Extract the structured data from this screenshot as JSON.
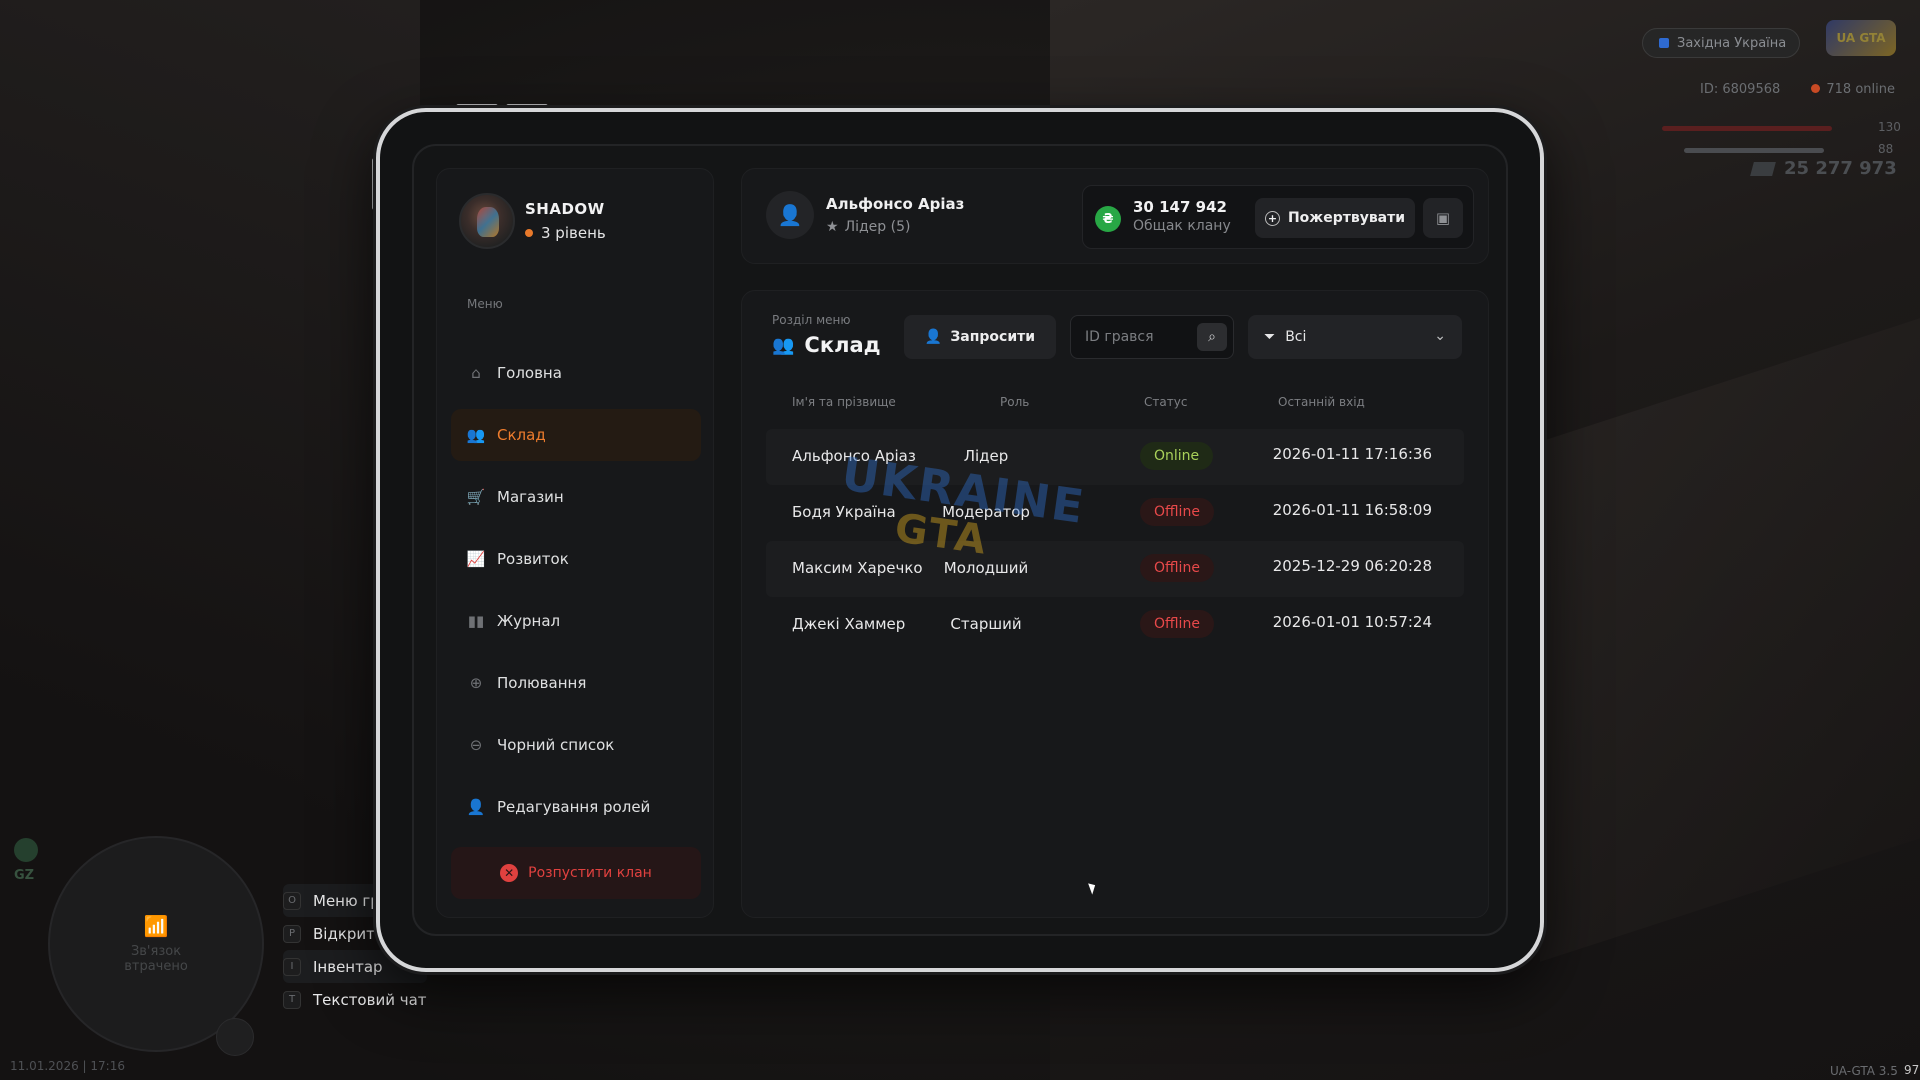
{
  "hud": {
    "server_name": "Західна Україна",
    "logo_text": "UA GTA",
    "player_id": "ID: 6809568",
    "online": "718 online",
    "health": "130",
    "armor": "88",
    "money": "25 277 973",
    "gz_label": "GZ",
    "minimap_text": "Зв'язок втрачено",
    "keys": [
      {
        "key": "O",
        "label": "Меню гри"
      },
      {
        "key": "P",
        "label": "Відкрити"
      },
      {
        "key": "I",
        "label": "Інвентар"
      },
      {
        "key": "T",
        "label": "Текстовий чат"
      }
    ],
    "datetime": "11.01.2026 | 17:16",
    "version": "UA-GTA 3.5",
    "fps": "97"
  },
  "sidebar": {
    "profile_name": "SHADOW",
    "profile_level": "3 рівень",
    "menu_label": "Меню",
    "items": [
      {
        "label": "Головна",
        "icon": "home-icon",
        "glyph": "⌂"
      },
      {
        "label": "Склад",
        "icon": "people-icon",
        "glyph": "👥"
      },
      {
        "label": "Магазин",
        "icon": "basket-icon",
        "glyph": "🛒"
      },
      {
        "label": "Розвиток",
        "icon": "chart-icon",
        "glyph": "📈"
      },
      {
        "label": "Журнал",
        "icon": "book-icon",
        "glyph": "▮▮"
      },
      {
        "label": "Полювання",
        "icon": "crosshair-icon",
        "glyph": "⊕"
      },
      {
        "label": "Чорний список",
        "icon": "block-icon",
        "glyph": "⊖"
      },
      {
        "label": "Редагування ролей",
        "icon": "user-edit-icon",
        "glyph": "👤"
      }
    ],
    "active_index": 1,
    "disband_label": "Розпустити клан"
  },
  "header": {
    "leader_name": "Альфонсо Аріаз",
    "leader_role": "Лідер (5)",
    "bank_amount": "30 147 942",
    "bank_label": "Общак клану",
    "coin_symbol": "₴",
    "donate_label": "Пожертвувати"
  },
  "main": {
    "section_sub": "Розділ меню",
    "section_title": "Склад",
    "invite_label": "Запросити",
    "search_placeholder": "ID грався",
    "filter_value": "Всі",
    "columns": [
      "Ім'я та прізвище",
      "Роль",
      "Статус",
      "Останній вхід"
    ],
    "rows": [
      {
        "name": "Альфонсо Аріаз",
        "role": "Лідер",
        "status": "Online",
        "last": "2026-01-11 17:16:36"
      },
      {
        "name": "Бодя Україна",
        "role": "Модератор",
        "status": "Offline",
        "last": "2026-01-11 16:58:09"
      },
      {
        "name": "Максим Харечко",
        "role": "Молодший",
        "status": "Offline",
        "last": "2025-12-29 06:20:28"
      },
      {
        "name": "Джекі Хаммер",
        "role": "Старший",
        "status": "Offline",
        "last": "2026-01-01 10:57:24"
      }
    ],
    "watermark_line1": "UKRAINE",
    "watermark_line2": "GTA"
  },
  "colors": {
    "accent": "#ef7d2d",
    "online": "#a9d15a",
    "offline": "#e8494a",
    "danger": "#e0413f",
    "coin": "#28a745"
  }
}
